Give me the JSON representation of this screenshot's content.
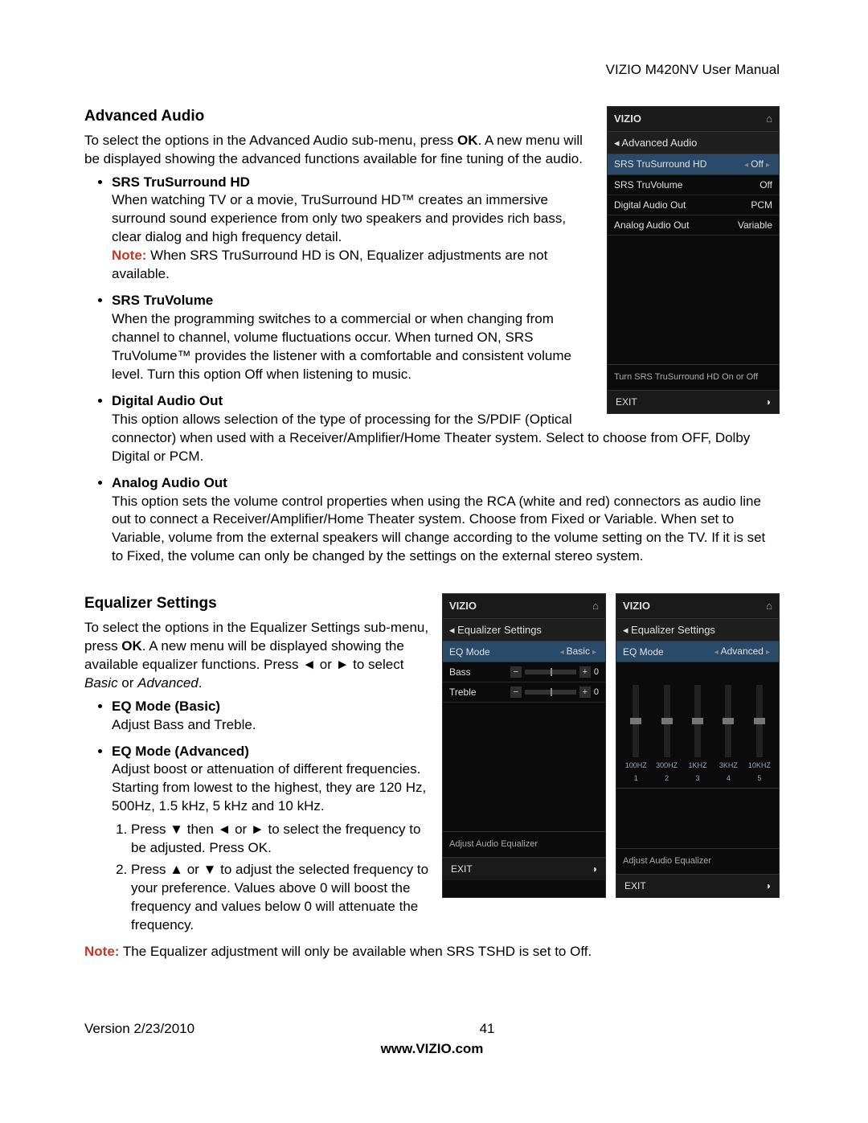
{
  "header": {
    "doc_title": "VIZIO M420NV User Manual"
  },
  "footer": {
    "version": "Version 2/23/2010",
    "page": "41",
    "url": "www.VIZIO.com"
  },
  "s1": {
    "heading": "Advanced Audio",
    "intro_a": "To select the options in the Advanced Audio sub-menu, press ",
    "intro_ok": "OK",
    "intro_b": ". A new menu will be displayed showing the advanced functions available for fine tuning of the audio.",
    "items": [
      {
        "title": "SRS TruSurround HD",
        "body": "When watching TV or a movie, TruSurround HD™ creates an immersive surround sound experience from only two speakers and provides rich bass, clear dialog and high frequency detail.",
        "note_label": "Note:",
        "note_body": " When SRS TruSurround HD is ON, Equalizer adjustments are not available."
      },
      {
        "title": "SRS TruVolume",
        "body": "When the programming switches to a commercial or when changing from channel to channel, volume fluctuations occur. When turned ON, SRS TruVolume™ provides the listener with a comfortable and consistent volume level. Turn this option Off when listening to music."
      },
      {
        "title": "Digital Audio Out",
        "body": "This option allows selection of the type of processing for the S/PDIF (Optical connector) when used with a Receiver/Amplifier/Home Theater system. Select to choose from OFF, Dolby Digital or PCM."
      },
      {
        "title": "Analog Audio Out",
        "body": "This option sets the volume control properties when using the RCA (white and red) connectors as audio line out to connect a Receiver/Amplifier/Home Theater system. Choose from Fixed or Variable. When set to Variable, volume from the external speakers will change according to the volume setting on the TV. If it is set to Fixed, the volume can only be changed by the settings on the external stereo system."
      }
    ]
  },
  "s2": {
    "heading": "Equalizer Settings",
    "intro_a": "To select the options in the Equalizer Settings sub-menu, press ",
    "intro_ok": "OK",
    "intro_b": ". A new menu will be displayed showing the available equalizer functions. Press ◄ or ► to select ",
    "intro_basic": "Basic",
    "intro_or": " or ",
    "intro_adv": "Advanced",
    "intro_end": ".",
    "items": [
      {
        "title": "EQ Mode (Basic)",
        "body": "Adjust Bass and Treble."
      },
      {
        "title": "EQ Mode (Advanced)",
        "body1": "Adjust boost or attenuation of different frequencies.",
        "body2": "Starting from lowest to the highest, they are 120 Hz, 500Hz, 1.5 kHz, 5 kHz and 10 kHz.",
        "steps": [
          "Press ▼ then ◄ or ► to select the frequency to be adjusted. Press OK.",
          "Press ▲ or ▼ to adjust the selected frequency to your preference. Values above 0 will boost the frequency and values below 0 will attenuate the frequency."
        ]
      }
    ],
    "note_label": "Note:",
    "note_body": " The Equalizer adjustment will only be available when SRS TSHD is set to Off."
  },
  "osd1": {
    "brand": "VIZIO",
    "bread": "Advanced Audio",
    "rows": [
      {
        "label": "SRS TruSurround HD",
        "value": "Off",
        "selected": true
      },
      {
        "label": "SRS TruVolume",
        "value": "Off"
      },
      {
        "label": "Digital Audio Out",
        "value": "PCM"
      },
      {
        "label": "Analog Audio Out",
        "value": "Variable"
      }
    ],
    "hint": "Turn SRS TruSurround HD On or Off",
    "exit": "EXIT"
  },
  "osd2": {
    "brand": "VIZIO",
    "bread": "Equalizer Settings",
    "mode_label": "EQ Mode",
    "mode_value": "Basic",
    "rows": [
      {
        "label": "Bass",
        "value": "0"
      },
      {
        "label": "Treble",
        "value": "0"
      }
    ],
    "hint": "Adjust Audio Equalizer",
    "exit": "EXIT"
  },
  "osd3": {
    "brand": "VIZIO",
    "bread": "Equalizer Settings",
    "mode_label": "EQ Mode",
    "mode_value": "Advanced",
    "freqs": [
      "100HZ",
      "300HZ",
      "1KHZ",
      "3KHZ",
      "10KHZ"
    ],
    "nums": [
      "1",
      "2",
      "3",
      "4",
      "5"
    ],
    "hint": "Adjust Audio Equalizer",
    "exit": "EXIT"
  }
}
